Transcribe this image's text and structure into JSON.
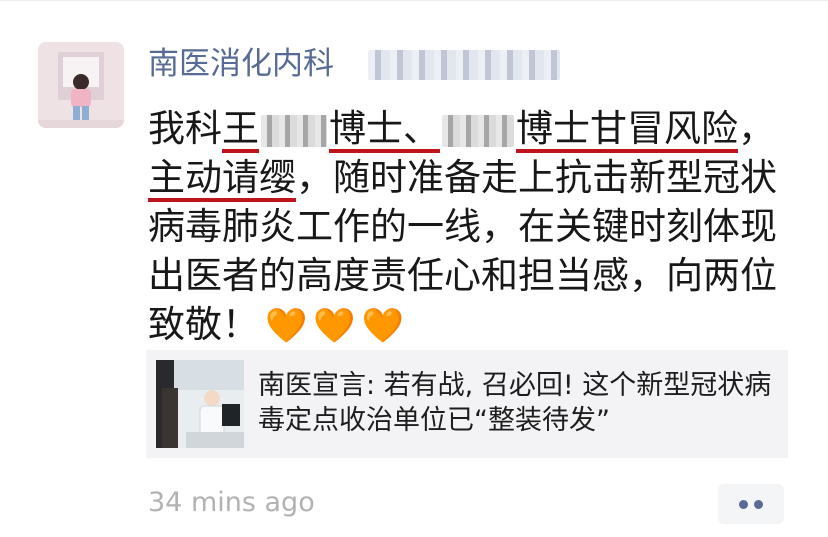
{
  "post": {
    "author": "南医消化内科",
    "text": {
      "s1": "我科",
      "u1": "王",
      "u2": "博士、",
      "u3": "博士甘冒风险",
      "s2": "，",
      "u4": "主动请缨",
      "s3": "，随时准备走上抗击新型冠状病毒肺炎工作的一线，在关键时刻体现出医者的高度责任心和担当感，向两位致敬！"
    },
    "hearts": [
      "🧡",
      "🧡",
      "🧡"
    ],
    "link_card": {
      "title": "南医宣言: 若有战, 召必回! 这个新型冠状病毒定点收治单位已“整装待发”"
    },
    "timestamp": "34 mins ago"
  },
  "colors": {
    "name": "#576b95",
    "underline": "#c0141c",
    "heart": "#f47a3c",
    "timestamp": "#b2b2b2",
    "card_bg": "#f3f3f5"
  },
  "icons": {
    "more_button": "two-dot-more-icon"
  }
}
